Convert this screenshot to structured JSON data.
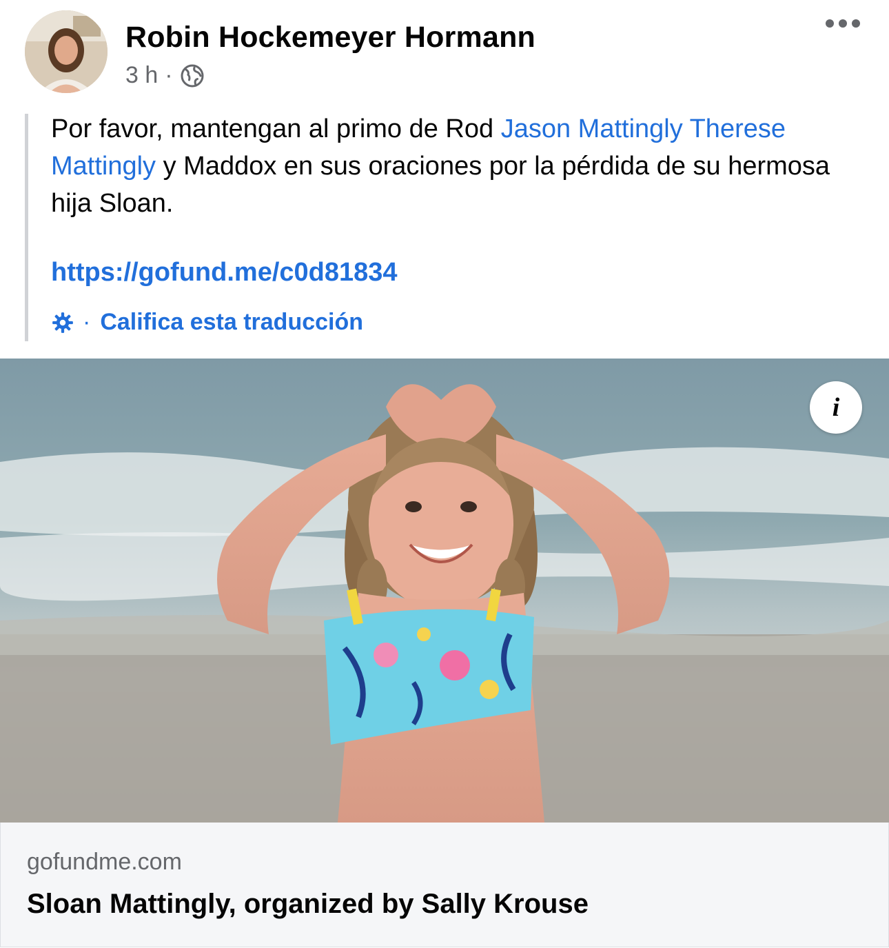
{
  "post": {
    "author": "Robin Hockemeyer Hormann",
    "time": "3 h",
    "separator": "·",
    "text_part1": "Por favor, mantengan al primo de Rod ",
    "mention1": "Jason Mattingly",
    "mention2": "Therese Mattingly",
    "text_part2": " y Maddox en sus oraciones por la pérdida de su hermosa hija Sloan.",
    "url": "https://gofund.me/c0d81834",
    "rate_dot": "·",
    "rate_translation": "Califica esta traducción",
    "info_icon": "i"
  },
  "link_preview": {
    "domain": "gofundme.com",
    "title": "Sloan Mattingly, organized by Sally Krouse"
  },
  "colors": {
    "link": "#216fdb",
    "text": "#050505",
    "secondary": "#65676b",
    "preview_bg": "#f5f6f8"
  }
}
